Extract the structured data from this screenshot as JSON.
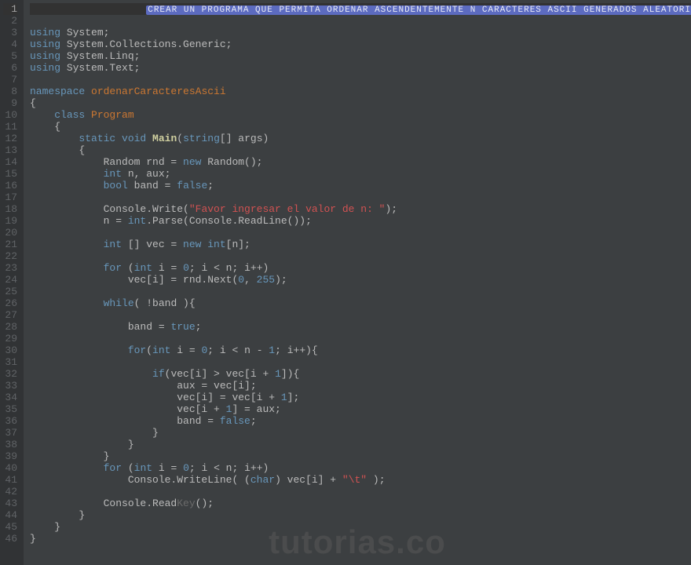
{
  "watermark": "tutorias.co",
  "lines": [
    {
      "n": 1,
      "current": true,
      "segs": [
        {
          "t": "                   ",
          "c": "pn"
        },
        {
          "t": "CREAR UN PROGRAMA QUE PERMITA ORDENAR ASCENDENTEMENTE N CARACTERES ASCII GENERADOS ALEATORIAMENTE",
          "c": "comment-hl"
        }
      ]
    },
    {
      "n": 2,
      "segs": []
    },
    {
      "n": 3,
      "segs": [
        {
          "t": "using",
          "c": "kw"
        },
        {
          "t": " System;",
          "c": "pn"
        }
      ]
    },
    {
      "n": 4,
      "segs": [
        {
          "t": "using",
          "c": "kw"
        },
        {
          "t": " System.Collections.Generic;",
          "c": "pn"
        }
      ]
    },
    {
      "n": 5,
      "segs": [
        {
          "t": "using",
          "c": "kw"
        },
        {
          "t": " System.Linq;",
          "c": "pn"
        }
      ]
    },
    {
      "n": 6,
      "segs": [
        {
          "t": "using",
          "c": "kw"
        },
        {
          "t": " System.Text;",
          "c": "pn"
        }
      ]
    },
    {
      "n": 7,
      "segs": []
    },
    {
      "n": 8,
      "segs": [
        {
          "t": "namespace ",
          "c": "kw"
        },
        {
          "t": "ordenarCaracteresAscii",
          "c": "nsname"
        }
      ]
    },
    {
      "n": 9,
      "segs": [
        {
          "t": "{",
          "c": "pn"
        }
      ]
    },
    {
      "n": 10,
      "segs": [
        {
          "t": "    ",
          "c": "pn"
        },
        {
          "t": "class ",
          "c": "kw"
        },
        {
          "t": "Program",
          "c": "cls"
        }
      ]
    },
    {
      "n": 11,
      "segs": [
        {
          "t": "    {",
          "c": "pn"
        }
      ]
    },
    {
      "n": 12,
      "segs": [
        {
          "t": "        ",
          "c": "pn"
        },
        {
          "t": "static void ",
          "c": "kw"
        },
        {
          "t": "Main",
          "c": "main"
        },
        {
          "t": "(",
          "c": "pn"
        },
        {
          "t": "string",
          "c": "kw"
        },
        {
          "t": "[] args)",
          "c": "pn"
        }
      ]
    },
    {
      "n": 13,
      "segs": [
        {
          "t": "        {",
          "c": "pn"
        }
      ]
    },
    {
      "n": 14,
      "segs": [
        {
          "t": "            Random rnd = ",
          "c": "pn"
        },
        {
          "t": "new",
          "c": "kw"
        },
        {
          "t": " Random();",
          "c": "pn"
        }
      ]
    },
    {
      "n": 15,
      "segs": [
        {
          "t": "            ",
          "c": "pn"
        },
        {
          "t": "int",
          "c": "kw"
        },
        {
          "t": " n, aux;",
          "c": "pn"
        }
      ]
    },
    {
      "n": 16,
      "segs": [
        {
          "t": "            ",
          "c": "pn"
        },
        {
          "t": "bool",
          "c": "kw"
        },
        {
          "t": " band = ",
          "c": "pn"
        },
        {
          "t": "false",
          "c": "kw"
        },
        {
          "t": ";",
          "c": "pn"
        }
      ]
    },
    {
      "n": 17,
      "segs": []
    },
    {
      "n": 18,
      "segs": [
        {
          "t": "            Console.Write(",
          "c": "pn"
        },
        {
          "t": "\"Favor ingresar el valor de n: \"",
          "c": "str"
        },
        {
          "t": ");",
          "c": "pn"
        }
      ]
    },
    {
      "n": 19,
      "segs": [
        {
          "t": "            n = ",
          "c": "pn"
        },
        {
          "t": "int",
          "c": "kw"
        },
        {
          "t": ".Parse(Console.ReadLine());",
          "c": "pn"
        }
      ]
    },
    {
      "n": 20,
      "segs": []
    },
    {
      "n": 21,
      "segs": [
        {
          "t": "            ",
          "c": "pn"
        },
        {
          "t": "int",
          "c": "kw"
        },
        {
          "t": " [] vec = ",
          "c": "pn"
        },
        {
          "t": "new int",
          "c": "kw"
        },
        {
          "t": "[n];",
          "c": "pn"
        }
      ]
    },
    {
      "n": 22,
      "segs": []
    },
    {
      "n": 23,
      "segs": [
        {
          "t": "            ",
          "c": "pn"
        },
        {
          "t": "for",
          "c": "kw"
        },
        {
          "t": " (",
          "c": "pn"
        },
        {
          "t": "int",
          "c": "kw"
        },
        {
          "t": " i = ",
          "c": "pn"
        },
        {
          "t": "0",
          "c": "num"
        },
        {
          "t": "; i < n; i++)",
          "c": "pn"
        }
      ]
    },
    {
      "n": 24,
      "segs": [
        {
          "t": "                vec[i] = rnd.Next(",
          "c": "pn"
        },
        {
          "t": "0",
          "c": "num"
        },
        {
          "t": ", ",
          "c": "pn"
        },
        {
          "t": "255",
          "c": "num"
        },
        {
          "t": ");",
          "c": "pn"
        }
      ]
    },
    {
      "n": 25,
      "segs": []
    },
    {
      "n": 26,
      "segs": [
        {
          "t": "            ",
          "c": "pn"
        },
        {
          "t": "while",
          "c": "kw"
        },
        {
          "t": "( !band ){",
          "c": "pn"
        }
      ]
    },
    {
      "n": 27,
      "segs": []
    },
    {
      "n": 28,
      "segs": [
        {
          "t": "                band = ",
          "c": "pn"
        },
        {
          "t": "true",
          "c": "kw"
        },
        {
          "t": ";",
          "c": "pn"
        }
      ]
    },
    {
      "n": 29,
      "segs": []
    },
    {
      "n": 30,
      "segs": [
        {
          "t": "                ",
          "c": "pn"
        },
        {
          "t": "for",
          "c": "kw"
        },
        {
          "t": "(",
          "c": "pn"
        },
        {
          "t": "int",
          "c": "kw"
        },
        {
          "t": " i = ",
          "c": "pn"
        },
        {
          "t": "0",
          "c": "num"
        },
        {
          "t": "; i < n - ",
          "c": "pn"
        },
        {
          "t": "1",
          "c": "num"
        },
        {
          "t": "; i++){",
          "c": "pn"
        }
      ]
    },
    {
      "n": 31,
      "segs": []
    },
    {
      "n": 32,
      "segs": [
        {
          "t": "                    ",
          "c": "pn"
        },
        {
          "t": "if",
          "c": "kw"
        },
        {
          "t": "(vec[i] > vec[i + ",
          "c": "pn"
        },
        {
          "t": "1",
          "c": "num"
        },
        {
          "t": "]){",
          "c": "pn"
        }
      ]
    },
    {
      "n": 33,
      "segs": [
        {
          "t": "                        aux = vec[i];",
          "c": "pn"
        }
      ]
    },
    {
      "n": 34,
      "segs": [
        {
          "t": "                        vec[i] = vec[i + ",
          "c": "pn"
        },
        {
          "t": "1",
          "c": "num"
        },
        {
          "t": "];",
          "c": "pn"
        }
      ]
    },
    {
      "n": 35,
      "segs": [
        {
          "t": "                        vec[i + ",
          "c": "pn"
        },
        {
          "t": "1",
          "c": "num"
        },
        {
          "t": "] = aux;",
          "c": "pn"
        }
      ]
    },
    {
      "n": 36,
      "segs": [
        {
          "t": "                        band = ",
          "c": "pn"
        },
        {
          "t": "false",
          "c": "kw"
        },
        {
          "t": ";",
          "c": "pn"
        }
      ]
    },
    {
      "n": 37,
      "segs": [
        {
          "t": "                    }",
          "c": "pn"
        }
      ]
    },
    {
      "n": 38,
      "segs": [
        {
          "t": "                }",
          "c": "pn"
        }
      ]
    },
    {
      "n": 39,
      "segs": [
        {
          "t": "            }",
          "c": "pn"
        }
      ]
    },
    {
      "n": 40,
      "segs": [
        {
          "t": "            ",
          "c": "pn"
        },
        {
          "t": "for",
          "c": "kw"
        },
        {
          "t": " (",
          "c": "pn"
        },
        {
          "t": "int",
          "c": "kw"
        },
        {
          "t": " i = ",
          "c": "pn"
        },
        {
          "t": "0",
          "c": "num"
        },
        {
          "t": "; i < n; i++)",
          "c": "pn"
        }
      ]
    },
    {
      "n": 41,
      "segs": [
        {
          "t": "                Console.WriteLine( (",
          "c": "pn"
        },
        {
          "t": "char",
          "c": "kw"
        },
        {
          "t": ") vec[i] + ",
          "c": "pn"
        },
        {
          "t": "\"\\t\"",
          "c": "str"
        },
        {
          "t": " );",
          "c": "pn"
        }
      ]
    },
    {
      "n": 42,
      "segs": []
    },
    {
      "n": 43,
      "segs": [
        {
          "t": "            Console.Read",
          "c": "pn"
        },
        {
          "t": "Key",
          "c": "faded"
        },
        {
          "t": "();",
          "c": "pn"
        }
      ]
    },
    {
      "n": 44,
      "segs": [
        {
          "t": "        }",
          "c": "pn"
        }
      ]
    },
    {
      "n": 45,
      "segs": [
        {
          "t": "    }",
          "c": "pn"
        }
      ]
    },
    {
      "n": 46,
      "segs": [
        {
          "t": "}",
          "c": "pn"
        }
      ]
    }
  ]
}
